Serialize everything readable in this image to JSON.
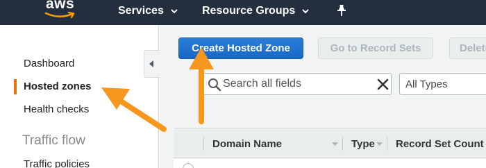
{
  "topnav": {
    "logo_text": "aws",
    "services_label": "Services",
    "resource_groups_label": "Resource Groups"
  },
  "sidebar": {
    "items": [
      {
        "label": "Dashboard"
      },
      {
        "label": "Hosted zones",
        "active": true
      },
      {
        "label": "Health checks"
      }
    ],
    "section_title": "Traffic flow",
    "section_items": [
      {
        "label": "Traffic policies"
      }
    ]
  },
  "toolbar": {
    "create_label": "Create Hosted Zone",
    "goto_label": "Go to Record Sets",
    "delete_label": "Delete Hosted Zone"
  },
  "filter": {
    "search_placeholder": "Search all fields",
    "type_select_value": "All Types"
  },
  "table": {
    "columns": [
      {
        "label": "Domain Name"
      },
      {
        "label": "Type"
      },
      {
        "label": "Record Set Count"
      }
    ]
  },
  "colors": {
    "nav_bg": "#232f3e",
    "primary": "#1f6fcf",
    "accent_orange": "#f7971e",
    "active_bar": "#ec7211"
  },
  "icons": [
    "pin-icon",
    "caret-down-icon",
    "collapse-arrow-icon",
    "search-icon",
    "clear-icon",
    "sort-caret-icon"
  ]
}
